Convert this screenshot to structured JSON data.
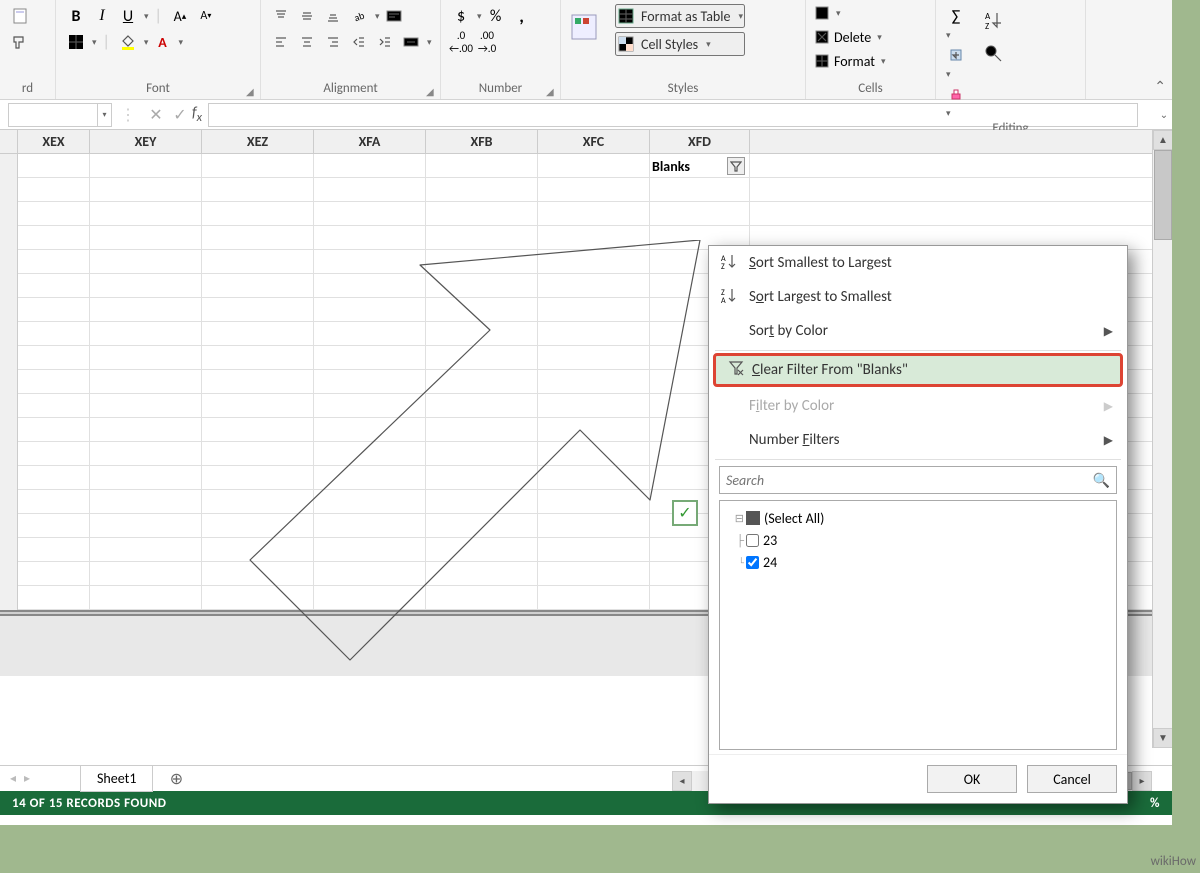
{
  "ribbon": {
    "groups": {
      "font": {
        "label": "Font"
      },
      "alignment": {
        "label": "Alignment"
      },
      "number": {
        "label": "Number"
      },
      "styles": {
        "label": "Styles",
        "format_table": "Format as Table",
        "cell_styles": "Cell Styles"
      },
      "cells": {
        "label": "Cells",
        "delete": "Delete",
        "format": "Format"
      },
      "editing": {
        "label": "Editing"
      },
      "clipboard_suffix": "rd"
    },
    "symbols": {
      "dollar": "$",
      "percent": "%"
    }
  },
  "columns": [
    "XEX",
    "XEY",
    "XEZ",
    "XFA",
    "XFB",
    "XFC",
    "XFD"
  ],
  "blanks_label": "Blanks",
  "filter_menu": {
    "sort_asc": "Sort Smallest to Largest",
    "sort_desc": "Sort Largest to Smallest",
    "sort_color": "Sort by Color",
    "clear_filter": "Clear Filter From \"Blanks\"",
    "filter_color": "Filter by Color",
    "number_filters": "Number Filters",
    "search_placeholder": "Search",
    "tree": {
      "select_all": "(Select All)",
      "v1": "23",
      "v2": "24"
    },
    "ok": "OK",
    "cancel": "Cancel"
  },
  "sheet": {
    "name": "Sheet1"
  },
  "status": {
    "text": "14 OF 15 RECORDS FOUND",
    "right_pct": "%"
  },
  "watermark": "wikiHow"
}
